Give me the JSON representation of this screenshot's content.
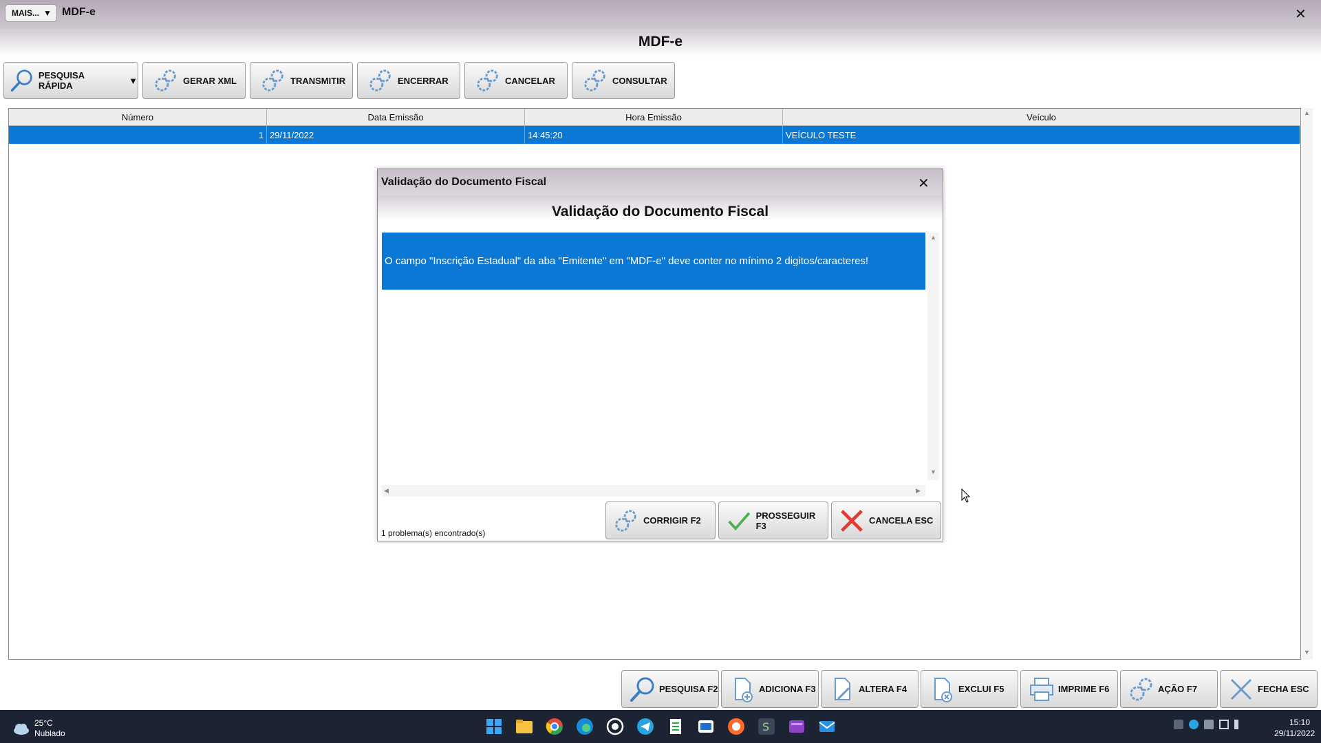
{
  "window": {
    "mais_label": "MAIS...",
    "title": "MDF-e",
    "close_symbol": "✕"
  },
  "module_title": "MDF-e",
  "toolbar": {
    "pesquisa_rapida": "PESQUISA RÁPIDA",
    "gerar_xml": "GERAR XML",
    "transmitir": "TRANSMITIR",
    "encerrar": "ENCERRAR",
    "cancelar": "CANCELAR",
    "consultar": "CONSULTAR",
    "dropdown_symbol": "▼"
  },
  "grid": {
    "columns": [
      "Número",
      "Data Emissão",
      "Hora Emissão",
      "Veículo"
    ],
    "rows": [
      {
        "numero": "1",
        "data": "29/11/2022",
        "hora": "14:45:20",
        "veiculo": "VEÍCULO TESTE"
      }
    ]
  },
  "dialog": {
    "title": "Validação do Documento Fiscal",
    "heading": "Validação do Documento Fiscal",
    "close_symbol": "✕",
    "messages": [
      "O campo \"Inscrição Estadual\" da aba \"Emitente\" em \"MDF-e\" deve conter no mínimo 2 digitos/caracteres!"
    ],
    "status": "1 problema(s) encontrado(s)",
    "buttons": {
      "corrigir": "CORRIGIR F2",
      "prosseguir": "PROSSEGUIR F3",
      "cancela": "CANCELA ESC"
    }
  },
  "bottom_bar": {
    "pesquisa": "PESQUISA F2",
    "adiciona": "ADICIONA F3",
    "altera": "ALTERA F4",
    "exclui": "EXCLUI F5",
    "imprime": "IMPRIME F6",
    "acao": "AÇÃO F7",
    "fecha": "FECHA ESC"
  },
  "taskbar": {
    "temperature": "25°C",
    "weather": "Nublado",
    "time": "15:10",
    "date": "29/11/2022",
    "apps": [
      "windows-start-icon",
      "file-explorer-icon",
      "chrome-icon",
      "edge-icon",
      "whatsapp-icon",
      "telegram-icon",
      "spreadsheet-icon",
      "outlook-icon",
      "browser-icon",
      "erp-app-icon",
      "video-app-icon",
      "mail-app-icon"
    ]
  },
  "colors": {
    "selection_blue": "#0a78d4",
    "taskbar_bg": "#1c2433",
    "titlebar_purple": "#b4aab6"
  }
}
